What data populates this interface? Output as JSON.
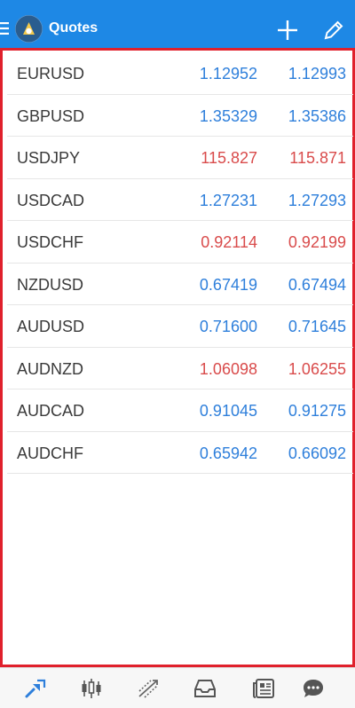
{
  "app_bar": {
    "title": "Quotes",
    "menu_icon": "hamburger-icon",
    "logo_icon": "app-logo-icon",
    "add_icon": "plus-icon",
    "edit_icon": "pencil-icon",
    "background": "#1e88e5"
  },
  "quotes": [
    {
      "symbol": "EURUSD",
      "bid": "1.12952",
      "ask": "1.12993",
      "direction": "up"
    },
    {
      "symbol": "GBPUSD",
      "bid": "1.35329",
      "ask": "1.35386",
      "direction": "up"
    },
    {
      "symbol": "USDJPY",
      "bid": "115.827",
      "ask": "115.871",
      "direction": "down"
    },
    {
      "symbol": "USDCAD",
      "bid": "1.27231",
      "ask": "1.27293",
      "direction": "up"
    },
    {
      "symbol": "USDCHF",
      "bid": "0.92114",
      "ask": "0.92199",
      "direction": "down"
    },
    {
      "symbol": "NZDUSD",
      "bid": "0.67419",
      "ask": "0.67494",
      "direction": "up"
    },
    {
      "symbol": "AUDUSD",
      "bid": "0.71600",
      "ask": "0.71645",
      "direction": "up"
    },
    {
      "symbol": "AUDNZD",
      "bid": "1.06098",
      "ask": "1.06255",
      "direction": "down"
    },
    {
      "symbol": "AUDCAD",
      "bid": "0.91045",
      "ask": "0.91275",
      "direction": "up"
    },
    {
      "symbol": "AUDCHF",
      "bid": "0.65942",
      "ask": "0.66092",
      "direction": "up"
    }
  ],
  "colors": {
    "up": "#2e7fdb",
    "down": "#d94b4b",
    "highlight_border": "#e0202c"
  },
  "bottom_nav": [
    {
      "name": "quotes-icon",
      "active": true
    },
    {
      "name": "chart-icon",
      "active": false
    },
    {
      "name": "trade-icon",
      "active": false
    },
    {
      "name": "history-icon",
      "active": false
    },
    {
      "name": "news-icon",
      "active": false
    },
    {
      "name": "messages-icon",
      "active": false
    }
  ]
}
